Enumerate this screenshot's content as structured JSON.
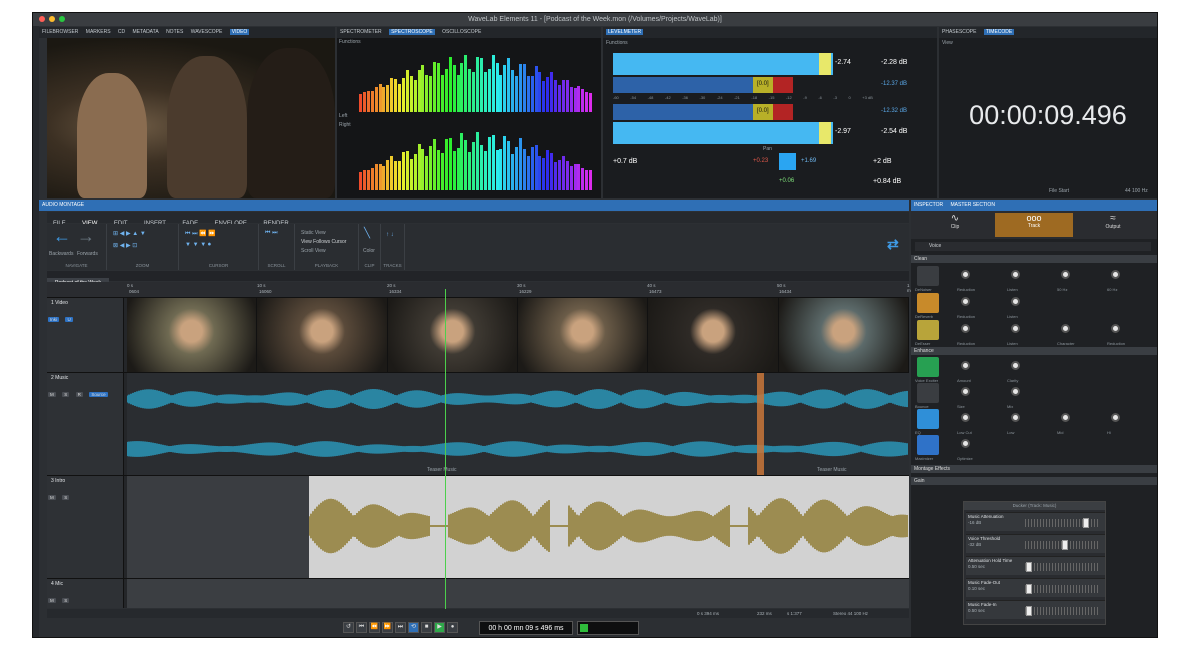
{
  "window": {
    "title": "WaveLab Elements 11 - [Podcast of the Week.mon (/Volumes/Projects/WaveLab)]"
  },
  "colors": {
    "accent": "#2f6fb5",
    "wave_blue": "#2ba3c9",
    "wave_gold": "#8a7426",
    "playhead": "#4ccf4c"
  },
  "top_left_tabs": [
    "FILEBROWSER",
    "MARKERS",
    "CD",
    "METADATA",
    "NOTES",
    "WAVESCOPE",
    "VIDEO"
  ],
  "spectro_tabs": [
    "SPECTROMETER",
    "SPECTROSCOPE",
    "OSCILLOSCOPE"
  ],
  "spectro": {
    "functions": "Functions",
    "left": "Left",
    "right": "Right"
  },
  "level": {
    "tab": "LEVELMETER",
    "functions": "Functions",
    "l_value": "-2.74",
    "l_peak": "-2.28 dB",
    "l_mid": "[0.0]",
    "l_minus": "-12.37 dB",
    "r_mid": "[0.0]",
    "r_minus": "-12.32 dB",
    "r_value": "-2.97",
    "r_peak": "-2.54 dB",
    "pan_label": "Pan",
    "left_db": "+0.7 dB",
    "pan_red": "+0.23",
    "pan_blue": "+1.69",
    "pan_green": "+0.06",
    "right_db1": "+2 dB",
    "right_db2": "+0.84 dB",
    "scale": [
      "-60",
      "-54",
      "-48",
      "-42",
      "-36",
      "-30",
      "-24",
      "-21",
      "-18",
      "-15",
      "-12",
      "-9",
      "-6",
      "-3",
      "0",
      "+3 dB"
    ]
  },
  "time_tabs": [
    "PHASESCOPE",
    "TIMECODE"
  ],
  "timecode": {
    "display": "00:00:09.496",
    "file_start": "File Start",
    "rate": "44 100 Hz",
    "view": "View"
  },
  "montage": {
    "label": "AUDIO MONTAGE",
    "menu": [
      "FILE",
      "VIEW",
      "EDIT",
      "INSERT",
      "FADE",
      "ENVELOPE",
      "RENDER"
    ],
    "groups": [
      "NAVIGATE",
      "ZOOM",
      "CURSOR",
      "SCROLL",
      "PLAYBACK",
      "CLIP",
      "TRACKS"
    ],
    "nav": [
      "Backwards",
      "Forwards"
    ],
    "playback": [
      "Static View",
      "View Follows Cursor",
      "Scroll View"
    ],
    "clip_color": "Color",
    "tab": "Podcast of the Week",
    "ruler": [
      "0 s",
      "10 s",
      "20 s",
      "30 s",
      "40 s",
      "50 s",
      "1 mn"
    ],
    "timecodes": [
      "0604",
      "16060",
      "16334",
      "16229",
      "16473",
      "16434"
    ],
    "tracks": [
      {
        "num": "1",
        "name": "Video",
        "btns": [
          "Inki",
          "U"
        ]
      },
      {
        "num": "2",
        "name": "Music",
        "btns": [
          "M",
          "S",
          "R",
          "Source"
        ]
      },
      {
        "num": "3",
        "name": "Intro",
        "btns": [
          "M",
          "S"
        ]
      },
      {
        "num": "4",
        "name": "Mic",
        "btns": [
          "M",
          "S"
        ]
      }
    ],
    "clip_labels": [
      "Teaser Music",
      "Teaser Music"
    ],
    "status": [
      "0 s 394 ms",
      "232 ms",
      "s 1:377",
      "Stereo 44 100 Hz"
    ]
  },
  "transport": {
    "time": "00 h 00 mn 09 s 496 ms"
  },
  "inspector": {
    "tabs": [
      "INSPECTOR",
      "MASTER SECTION"
    ],
    "modes": [
      "Clip",
      "Track",
      "Output"
    ],
    "plugin_name": "Voice",
    "sections": [
      "Clean",
      "Enhance",
      "Montage Effects",
      "Gain"
    ],
    "clean_row1": [
      "DeNoiser",
      "Reduction",
      "Listen",
      "50 Hz",
      "60 Hz"
    ],
    "clean_row2": [
      "DeReverb",
      "Reduction",
      "Listen"
    ],
    "clean_row3": [
      "DeEsser",
      "Reduction",
      "Listen",
      "Character",
      "Reduction"
    ],
    "enhance_row1": [
      "Voice Exciter",
      "Amount",
      "Clarity"
    ],
    "enhance_row2": [
      "Bounce",
      "Size",
      "Mix"
    ],
    "enhance_row3": [
      "EQ",
      "Low Cut",
      "Low",
      "Mid",
      "Hi"
    ],
    "enhance_row4": [
      "Maximizer",
      "Optimize"
    ]
  },
  "ducker": {
    "title": "Ducker (Track: Music)",
    "rows": [
      {
        "label": "Music Attenuation",
        "value": "-16 dB",
        "pos": 0.85
      },
      {
        "label": "Voice Threshold",
        "value": "-32 dB",
        "pos": 0.55
      },
      {
        "label": "Attenuation Hold Time",
        "value": "0.50 sec",
        "pos": 0.02
      },
      {
        "label": "Music Fade-Out",
        "value": "0.10 sec",
        "pos": 0.02
      },
      {
        "label": "Music Fade-In",
        "value": "0.50 sec",
        "pos": 0.02
      }
    ]
  }
}
